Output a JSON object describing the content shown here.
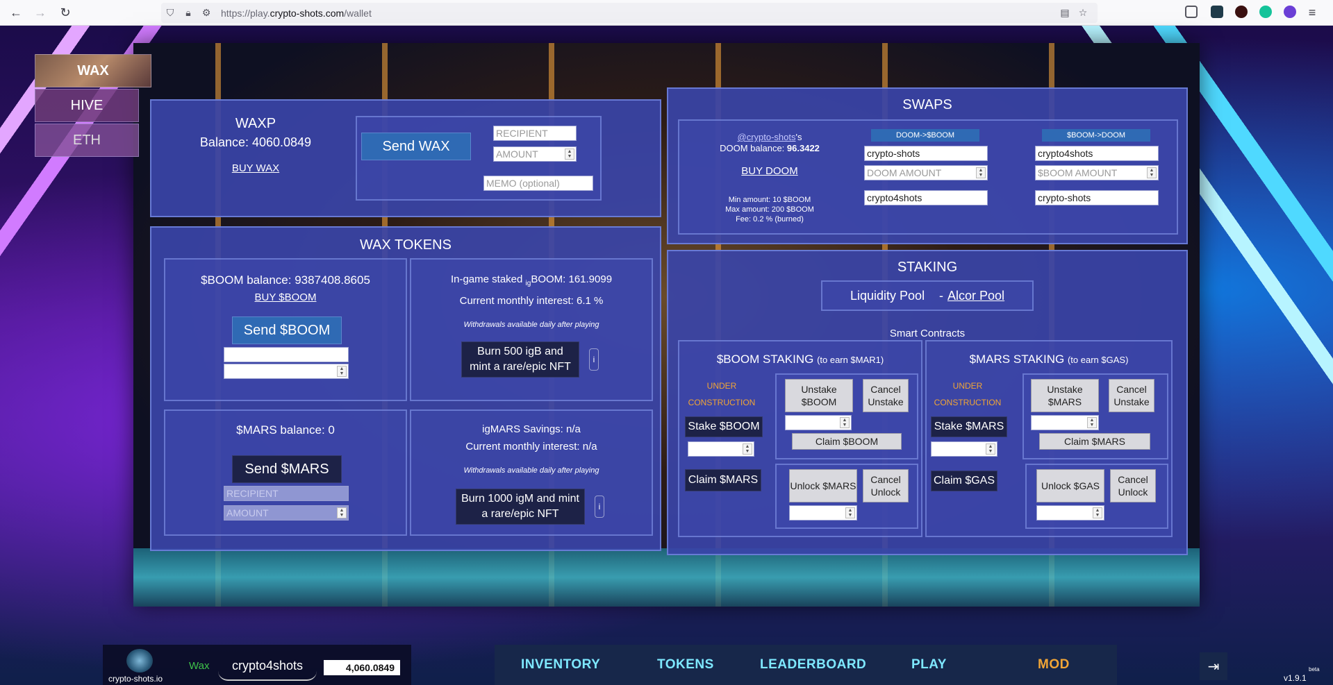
{
  "browser": {
    "url_prefix": "https://play.",
    "url_domain": "crypto-shots.com",
    "url_path": "/wallet"
  },
  "chains": [
    "WAX",
    "HIVE",
    "ETH"
  ],
  "waxp": {
    "title": "WAXP",
    "balance": "Balance: 4060.0849",
    "buy_link": "BUY WAX",
    "send_button": "Send WAX",
    "recipient_placeholder": "RECIPIENT",
    "amount_placeholder": "AMOUNT",
    "memo_placeholder": "MEMO (optional)"
  },
  "wax_tokens": {
    "title": "WAX TOKENS",
    "boom_balance": "$BOOM balance: 9387408.8605",
    "buy_boom": "BUY $BOOM",
    "send_boom": "Send $BOOM",
    "staked_prefix": "In-game staked ",
    "staked_sub": "ig",
    "staked_suffix": "BOOM: 161.9099",
    "boom_interest": "Current monthly interest: 6.1 %",
    "withdraw_note": "Withdrawals available daily after playing",
    "burn_boom": "Burn 500 igB and mint a rare/epic NFT",
    "info": "i",
    "mars_balance": "$MARS balance: 0",
    "send_mars": "Send $MARS",
    "mars_recipient": "RECIPIENT",
    "mars_amount": "AMOUNT",
    "igmars_savings": "igMARS Savings: n/a",
    "mars_interest": "Current monthly interest: n/a",
    "withdraw_note2": "Withdrawals available daily after playing",
    "burn_mars": "Burn 1000 igM and mint a rare/epic NFT"
  },
  "swaps": {
    "title": "SWAPS",
    "account_link": "@crypto-shots",
    "account_suffix": "'s",
    "doom_balance_label": "DOOM balance: ",
    "doom_balance_value": "96.3422",
    "buy_doom": "BUY DOOM",
    "min_amount": "Min amount: 10 $BOOM",
    "max_amount": "Max amount: 200 $BOOM",
    "fee": "Fee: 0.2 % (burned)",
    "doom_to_boom": "DOOM->$BOOM",
    "boom_to_doom": "$BOOM->DOOM",
    "d2b_from": "crypto-shots",
    "d2b_amount_placeholder": "DOOM AMOUNT",
    "d2b_to": "crypto4shots",
    "b2d_from": "crypto4shots",
    "b2d_amount_placeholder": "$BOOM AMOUNT",
    "b2d_to": "crypto-shots"
  },
  "staking": {
    "title": "STAKING",
    "liquidity_pool": "Liquidity Pool",
    "separator": "-",
    "alcor_pool": "Alcor Pool",
    "smart_contracts": "Smart Contracts",
    "boom_staking_title": "$BOOM STAKING",
    "boom_staking_sub": "(to earn $MAR1)",
    "mars_staking_title": "$MARS STAKING",
    "mars_staking_sub": "(to earn $GAS)",
    "under": "UNDER",
    "construction": "CONSTRUCTION",
    "stake_boom": "Stake $BOOM",
    "unstake_boom": "Unstake $BOOM",
    "cancel_unstake": "Cancel Unstake",
    "claim_boom": "Claim $BOOM",
    "claim_mars": "Claim $MARS",
    "unlock_mars": "Unlock $MARS",
    "cancel_unlock": "Cancel Unlock",
    "stake_mars": "Stake $MARS",
    "unstake_mars": "Unstake $MARS",
    "claim_mars2": "Claim $MARS",
    "claim_gas": "Claim $GAS",
    "unlock_gas": "Unlock $GAS"
  },
  "bottom": {
    "site": "crypto-shots.io",
    "chain": "Wax",
    "username": "crypto4shots",
    "balance": "4,060.0849",
    "nav": [
      "INVENTORY",
      "TOKENS",
      "LEADERBOARD",
      "PLAY",
      "MOD"
    ],
    "version": "v1.9.1",
    "beta": "beta"
  }
}
